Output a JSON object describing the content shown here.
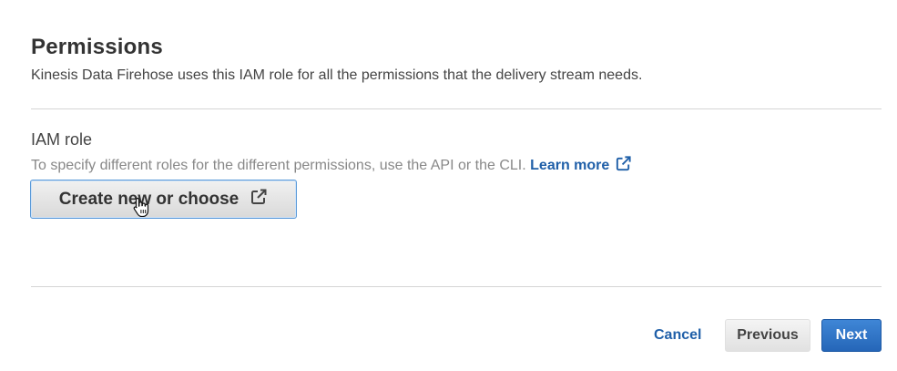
{
  "permissions": {
    "title": "Permissions",
    "description": "Kinesis Data Firehose uses this IAM role for all the permissions that the delivery stream needs."
  },
  "iam_role": {
    "label": "IAM role",
    "description": "To specify different roles for the different permissions, use the API or the CLI.",
    "learn_more": "Learn more",
    "create_button": "Create new or choose"
  },
  "footer": {
    "cancel": "Cancel",
    "previous": "Previous",
    "next": "Next"
  },
  "icons": {
    "external_link": "external-link-icon",
    "cursor": "hand-pointer-icon"
  },
  "colors": {
    "link": "#1f5fa8",
    "primary": "#2f74c8",
    "focus_border": "#5b9ad9"
  }
}
